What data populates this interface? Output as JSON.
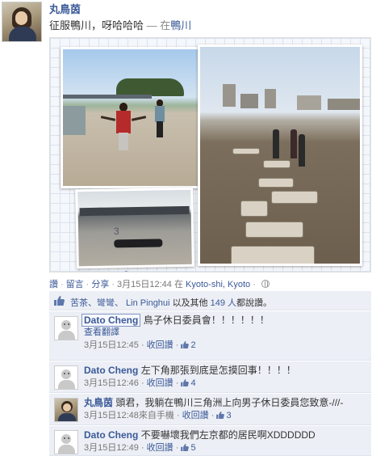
{
  "post": {
    "author": "丸鳥茵",
    "text": "征服鴨川，呀哈哈哈",
    "location_sep": " — 在",
    "location": "鴨川",
    "collage_number": "3"
  },
  "actions": {
    "like": "讚",
    "comment": "留言",
    "share": "分享",
    "sep": "·",
    "timestamp": "3月15日12:44",
    "place_prefix": "在",
    "place": "Kyoto-shi, Kyoto"
  },
  "likes": {
    "names": "苦茶、彎彎、 Lin Pinghui",
    "middle": "以及其他",
    "others": "149 人",
    "suffix": "都說讚。"
  },
  "comments": [
    {
      "author": "Dato Cheng",
      "text": "鳥子休日委員會！！！！！！",
      "translate": "查看翻譯",
      "time": "3月15日12:45",
      "sep": " · ",
      "retract": "收回讚",
      "likes": "2"
    },
    {
      "author": "Dato Cheng",
      "text": "左下角那張到底是怎摸回事！！！！",
      "time": "3月15日12:46",
      "sep": " · ",
      "retract": "收回讚",
      "likes": "4"
    },
    {
      "author": "丸鳥茵",
      "text": "頭君，我躺在鴨川三角洲上向男子休日委員您致意-///-",
      "time": "3月15日12:48",
      "via": "來自手機",
      "sep": " · ",
      "retract": "收回讚",
      "likes": "3"
    },
    {
      "author": "Dato Cheng",
      "text": "不要嚇壞我們左京都的居民啊XDDDDDD",
      "time": "3月15日12:49",
      "sep": " · ",
      "retract": "收回讚",
      "likes": "5"
    }
  ],
  "colors": {
    "link": "#3b5998",
    "feedback_bg": "#eceff5",
    "meta": "#777777"
  }
}
